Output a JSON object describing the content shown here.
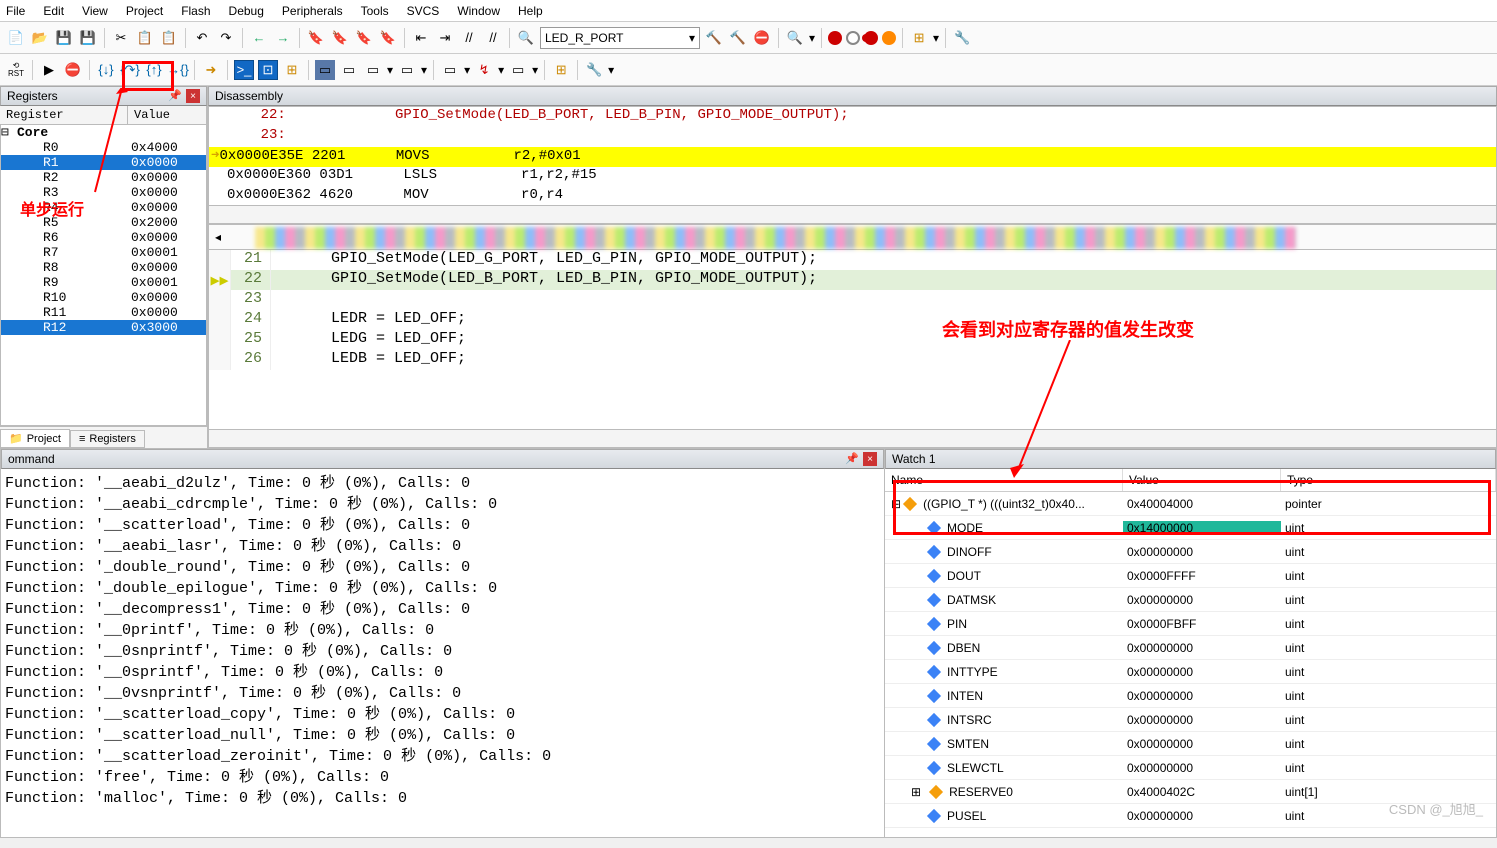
{
  "menu": {
    "items": [
      "File",
      "Edit",
      "View",
      "Project",
      "Flash",
      "Debug",
      "Peripherals",
      "Tools",
      "SVCS",
      "Window",
      "Help"
    ]
  },
  "toolbar": {
    "target_name": "LED_R_PORT"
  },
  "panes": {
    "registers_title": "Registers",
    "disassembly_title": "Disassembly",
    "command_title": "ommand",
    "watch_title": "Watch 1"
  },
  "reg_headers": {
    "name": "Register",
    "value": "Value"
  },
  "registers": {
    "group": "Core",
    "rows": [
      {
        "n": "R0",
        "v": "0x4000"
      },
      {
        "n": "R1",
        "v": "0x0000",
        "sel": true
      },
      {
        "n": "R2",
        "v": "0x0000"
      },
      {
        "n": "R3",
        "v": "0x0000"
      },
      {
        "n": "R4",
        "v": "0x0000"
      },
      {
        "n": "R5",
        "v": "0x2000"
      },
      {
        "n": "R6",
        "v": "0x0000"
      },
      {
        "n": "R7",
        "v": "0x0001"
      },
      {
        "n": "R8",
        "v": "0x0000"
      },
      {
        "n": "R9",
        "v": "0x0001"
      },
      {
        "n": "R10",
        "v": "0x0000"
      },
      {
        "n": "R11",
        "v": "0x0000"
      },
      {
        "n": "R12",
        "v": "0x3000",
        "sel": true
      }
    ]
  },
  "bottom_tabs": {
    "project": "Project",
    "registers": "Registers"
  },
  "disasm": {
    "lines": [
      {
        "t": "    22:             GPIO_SetMode(LED_B_PORT, LED_B_PIN, GPIO_MODE_OUTPUT); ",
        "cls": "call"
      },
      {
        "t": "    23:  ",
        "cls": "call"
      },
      {
        "t": "0x0000E35E 2201      MOVS          r2,#0x01",
        "cls": "hi"
      },
      {
        "t": "0x0000E360 03D1      LSLS          r1,r2,#15",
        "cls": ""
      },
      {
        "t": "0x0000E362 4620      MOV           r0,r4",
        "cls": ""
      }
    ]
  },
  "editor": {
    "rows": [
      {
        "ln": "21",
        "code": "GPIO_SetMode(LED_G_PORT, LED_G_PIN, GPIO_MODE_OUTPUT);"
      },
      {
        "ln": "22",
        "code": "GPIO_SetMode(LED_B_PORT, LED_B_PIN, GPIO_MODE_OUTPUT);",
        "active": true
      },
      {
        "ln": "23",
        "code": ""
      },
      {
        "ln": "24",
        "code": "LEDR = LED_OFF;"
      },
      {
        "ln": "25",
        "code": "LEDG = LED_OFF;"
      },
      {
        "ln": "26",
        "code": "LEDB = LED_OFF;"
      }
    ]
  },
  "command": {
    "lines": [
      "Function: '__aeabi_d2ulz', Time: 0 秒 (0%), Calls: 0",
      "Function: '__aeabi_cdrcmple', Time: 0 秒 (0%), Calls: 0",
      "Function: '__scatterload', Time: 0 秒 (0%), Calls: 0",
      "Function: '__aeabi_lasr', Time: 0 秒 (0%), Calls: 0",
      "Function: '_double_round', Time: 0 秒 (0%), Calls: 0",
      "Function: '_double_epilogue', Time: 0 秒 (0%), Calls: 0",
      "Function: '__decompress1', Time: 0 秒 (0%), Calls: 0",
      "Function: '__0printf', Time: 0 秒 (0%), Calls: 0",
      "Function: '__0snprintf', Time: 0 秒 (0%), Calls: 0",
      "Function: '__0sprintf', Time: 0 秒 (0%), Calls: 0",
      "Function: '__0vsnprintf', Time: 0 秒 (0%), Calls: 0",
      "Function: '__scatterload_copy', Time: 0 秒 (0%), Calls: 0",
      "Function: '__scatterload_null', Time: 0 秒 (0%), Calls: 0",
      "Function: '__scatterload_zeroinit', Time: 0 秒 (0%), Calls: 0",
      "Function: 'free', Time: 0 秒 (0%), Calls: 0",
      "Function: 'malloc', Time: 0 秒 (0%), Calls: 0"
    ]
  },
  "watch": {
    "cols": {
      "name": "Name",
      "value": "Value",
      "type": "Type"
    },
    "root": {
      "name": "((GPIO_T *) (((uint32_t)0x40...",
      "value": "0x40004000",
      "type": "pointer"
    },
    "rows": [
      {
        "n": "MODE",
        "v": "0x14000000",
        "t": "uint",
        "mode": true
      },
      {
        "n": "DINOFF",
        "v": "0x00000000",
        "t": "uint"
      },
      {
        "n": "DOUT",
        "v": "0x0000FFFF",
        "t": "uint"
      },
      {
        "n": "DATMSK",
        "v": "0x00000000",
        "t": "uint"
      },
      {
        "n": "PIN",
        "v": "0x0000FBFF",
        "t": "uint"
      },
      {
        "n": "DBEN",
        "v": "0x00000000",
        "t": "uint"
      },
      {
        "n": "INTTYPE",
        "v": "0x00000000",
        "t": "uint"
      },
      {
        "n": "INTEN",
        "v": "0x00000000",
        "t": "uint"
      },
      {
        "n": "INTSRC",
        "v": "0x00000000",
        "t": "uint"
      },
      {
        "n": "SMTEN",
        "v": "0x00000000",
        "t": "uint"
      },
      {
        "n": "SLEWCTL",
        "v": "0x00000000",
        "t": "uint"
      },
      {
        "n": "RESERVE0",
        "v": "0x4000402C",
        "t": "uint[1]",
        "exp": true
      },
      {
        "n": "PUSEL",
        "v": "0x00000000",
        "t": "uint"
      }
    ]
  },
  "annotations": {
    "step": "单步运行",
    "watch_change": "会看到对应寄存器的值发生改变",
    "blog": "CSDN @_旭旭_"
  }
}
